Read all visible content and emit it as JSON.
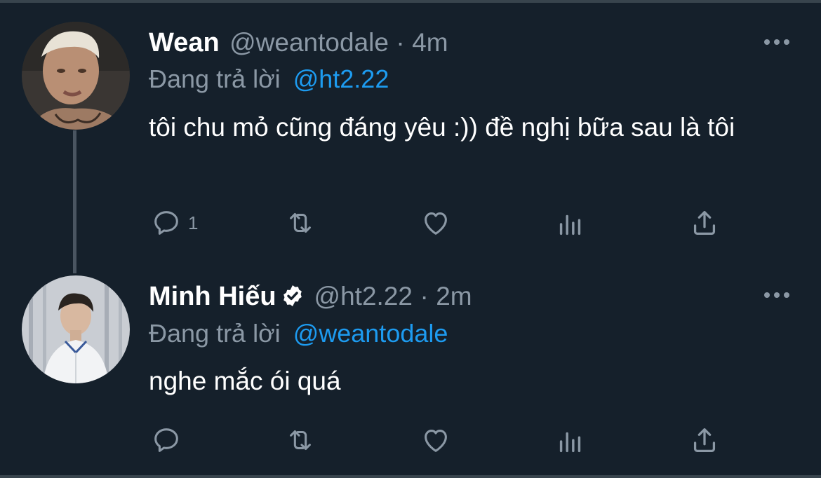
{
  "tweets": [
    {
      "name": "Wean",
      "handle": "@weantodale",
      "separator": "·",
      "time": "4m",
      "replying_prefix": "Đang trả lời",
      "replying_to": "@ht2.22",
      "text": "tôi chu mỏ cũng đáng yêu :)) đề nghị bữa sau là tôi",
      "reply_count": "1",
      "verified": false
    },
    {
      "name": "Minh Hiếu",
      "handle": "@ht2.22",
      "separator": "·",
      "time": "2m",
      "replying_prefix": "Đang trả lời",
      "replying_to": "@weantodale",
      "text": "nghe mắc ói quá",
      "reply_count": "",
      "verified": true
    }
  ],
  "colors": {
    "background": "#15202b",
    "text": "#ffffff",
    "secondary": "#8b98a5",
    "link": "#1d9bf0",
    "thread_line": "#4a5561"
  },
  "icons": [
    "reply-icon",
    "retweet-icon",
    "like-icon",
    "analytics-icon",
    "share-icon",
    "more-icon",
    "verified-badge-icon"
  ]
}
